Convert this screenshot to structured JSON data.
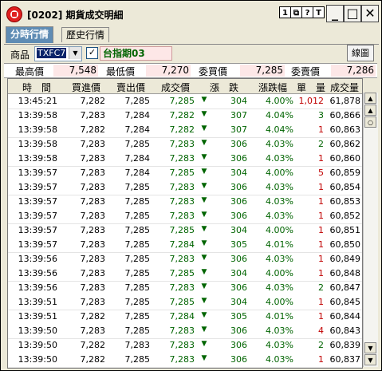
{
  "window": {
    "title": "[0202] 期貨成交明細"
  },
  "titlebar_buttons": [
    "1",
    "⧉",
    "?",
    "T"
  ],
  "window_controls": {
    "minimize": "_",
    "maximize": "□",
    "close": "✕"
  },
  "tabs": [
    {
      "label": "分時行情",
      "active": true
    },
    {
      "label": "歷史行情",
      "active": false
    }
  ],
  "toolbar": {
    "product_label": "商品",
    "product_value": "TXFC7",
    "product_name": "台指期03",
    "chart_button": "線圖"
  },
  "quote": {
    "high_label": "最高價",
    "high_value": "7,548",
    "low_label": "最低價",
    "low_value": "7,270",
    "bid_label": "委買價",
    "bid_value": "7,285",
    "ask_label": "委賣價",
    "ask_value": "7,286"
  },
  "columns": [
    "時　間",
    "買進價",
    "賣出價",
    "成交價",
    "漲　跌",
    "漲跌幅",
    "單　量",
    "成交量"
  ],
  "rows": [
    [
      "13:45:21",
      "7,282",
      "7,285",
      "7,285",
      "304",
      "4.00%",
      "1,012",
      "61,878"
    ],
    [
      "13:39:58",
      "7,283",
      "7,284",
      "7,282",
      "307",
      "4.04%",
      "3",
      "60,866"
    ],
    [
      "13:39:58",
      "7,282",
      "7,284",
      "7,282",
      "307",
      "4.04%",
      "1",
      "60,863"
    ],
    [
      "13:39:58",
      "7,283",
      "7,285",
      "7,283",
      "306",
      "4.03%",
      "2",
      "60,862"
    ],
    [
      "13:39:58",
      "7,283",
      "7,284",
      "7,283",
      "306",
      "4.03%",
      "1",
      "60,860"
    ],
    [
      "13:39:57",
      "7,283",
      "7,284",
      "7,285",
      "304",
      "4.00%",
      "5",
      "60,859"
    ],
    [
      "13:39:57",
      "7,283",
      "7,285",
      "7,283",
      "306",
      "4.03%",
      "1",
      "60,854"
    ],
    [
      "13:39:57",
      "7,283",
      "7,285",
      "7,283",
      "306",
      "4.03%",
      "1",
      "60,853"
    ],
    [
      "13:39:57",
      "7,283",
      "7,285",
      "7,283",
      "306",
      "4.03%",
      "1",
      "60,852"
    ],
    [
      "13:39:57",
      "7,283",
      "7,285",
      "7,285",
      "304",
      "4.00%",
      "1",
      "60,851"
    ],
    [
      "13:39:57",
      "7,283",
      "7,285",
      "7,284",
      "305",
      "4.01%",
      "1",
      "60,850"
    ],
    [
      "13:39:56",
      "7,283",
      "7,285",
      "7,283",
      "306",
      "4.03%",
      "1",
      "60,849"
    ],
    [
      "13:39:56",
      "7,283",
      "7,285",
      "7,285",
      "304",
      "4.00%",
      "1",
      "60,848"
    ],
    [
      "13:39:56",
      "7,283",
      "7,285",
      "7,283",
      "306",
      "4.03%",
      "2",
      "60,847"
    ],
    [
      "13:39:51",
      "7,283",
      "7,285",
      "7,285",
      "304",
      "4.00%",
      "1",
      "60,845"
    ],
    [
      "13:39:51",
      "7,282",
      "7,285",
      "7,284",
      "305",
      "4.01%",
      "1",
      "60,844"
    ],
    [
      "13:39:50",
      "7,283",
      "7,285",
      "7,283",
      "306",
      "4.03%",
      "4",
      "60,843"
    ],
    [
      "13:39:50",
      "7,282",
      "7,283",
      "7,283",
      "306",
      "4.03%",
      "2",
      "60,839"
    ],
    [
      "13:39:50",
      "7,282",
      "7,285",
      "7,283",
      "306",
      "4.03%",
      "1",
      "60,837"
    ]
  ],
  "colors": {
    "price_color": "#006400",
    "volume_color": "#c00000"
  },
  "change_direction_icon": "down-triangle-icon"
}
